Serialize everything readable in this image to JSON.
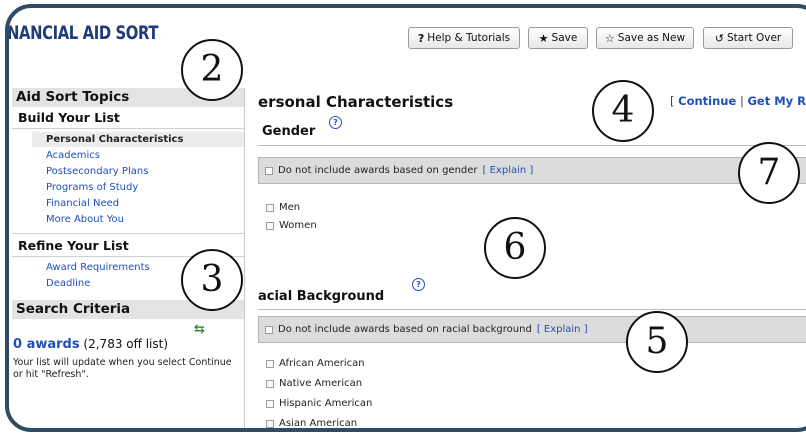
{
  "app": {
    "logo": "NANCIAL AID SORT"
  },
  "toolbar": {
    "help": {
      "icon": "?",
      "label": "Help & Tutorials"
    },
    "save": {
      "icon": "★",
      "label": "Save"
    },
    "save_new": {
      "icon": "☆",
      "label": "Save as New"
    },
    "start_over": {
      "icon": "↺",
      "label": "Start Over"
    }
  },
  "sidebar": {
    "heading": "Aid Sort Topics",
    "build_heading": "Build Your List",
    "build_items": [
      {
        "label": "Personal Characteristics"
      },
      {
        "label": "Academics"
      },
      {
        "label": "Postsecondary Plans"
      },
      {
        "label": "Programs of Study"
      },
      {
        "label": "Financial Need"
      },
      {
        "label": "More About You"
      }
    ],
    "refine_heading": "Refine Your List",
    "refine_items": [
      {
        "label": "Award Requirements"
      },
      {
        "label": "Deadline"
      }
    ],
    "criteria_heading": "Search Criteria",
    "awards_count": "0 awards",
    "off_list": "(2,783 off list)",
    "note": "Your list will update when you select Continue or hit \"Refresh\"."
  },
  "main": {
    "title": "ersonal Characteristics",
    "links": {
      "bracket_open": "[",
      "continue": "Continue",
      "sep": "|",
      "get_results": "Get My R"
    },
    "gender": {
      "title": "Gender",
      "bar_label": "Do not include awards based on gender",
      "explain": "[ Explain ]",
      "options": [
        "Men",
        "Women"
      ]
    },
    "racial": {
      "title": "acial Background",
      "bar_label": "Do not include awards based on racial background",
      "explain": "[ Explain ]",
      "options": [
        "African American",
        "Native American",
        "Hispanic American",
        "Asian American"
      ]
    }
  },
  "callouts": [
    "2",
    "3",
    "4",
    "5",
    "6",
    "7"
  ],
  "colors": {
    "frame": "#2f4b66",
    "link": "#1f4fb8",
    "logo": "#1e3c78"
  }
}
